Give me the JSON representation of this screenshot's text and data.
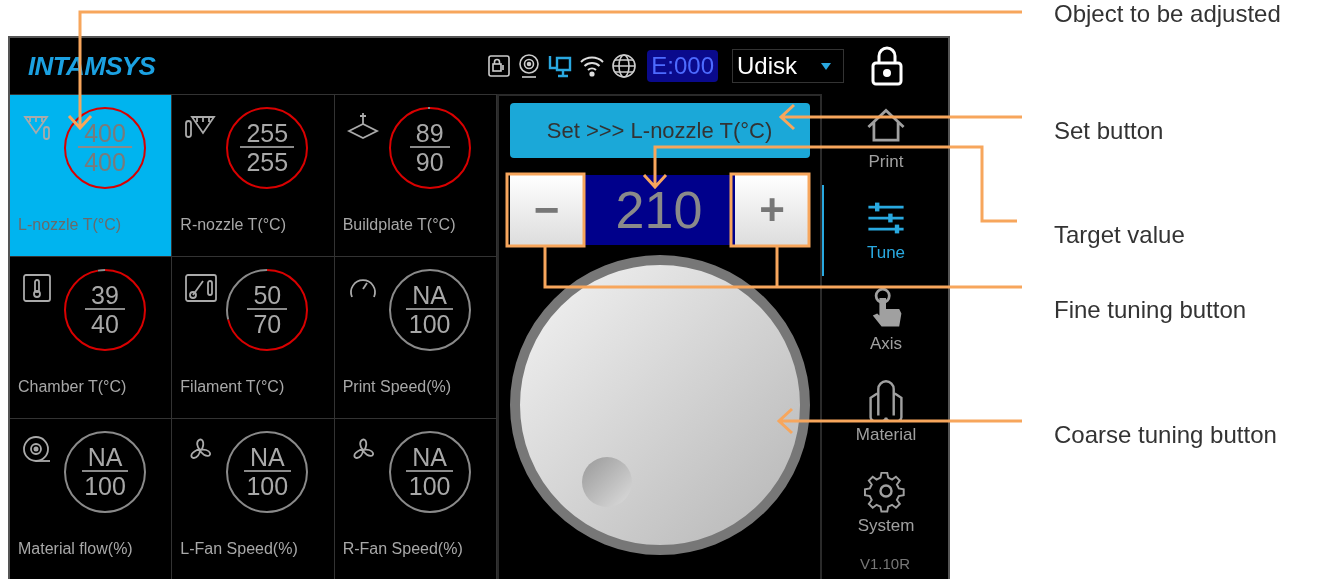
{
  "logo": "INTAMSYS",
  "status": {
    "error_code": "E:000",
    "storage": "Udisk"
  },
  "tiles": [
    {
      "kind": "nozzle-left",
      "current": "400",
      "target": "400",
      "label": "L-nozzle T(°C)",
      "level": 1,
      "selected": true
    },
    {
      "kind": "nozzle-right",
      "current": "255",
      "target": "255",
      "label": "R-nozzle T(°C)",
      "level": 1,
      "selected": false
    },
    {
      "kind": "buildplate",
      "current": "89",
      "target": "90",
      "label": "Buildplate T(°C)",
      "level": 0.99,
      "selected": false
    },
    {
      "kind": "chamber",
      "current": "39",
      "target": "40",
      "label": "Chamber T(°C)",
      "level": 0.97,
      "selected": false
    },
    {
      "kind": "filament",
      "current": "50",
      "target": "70",
      "label": "Filament T(°C)",
      "level": 0.71,
      "selected": false
    },
    {
      "kind": "speed",
      "current": "NA",
      "target": "100",
      "label": "Print Speed(%)",
      "level": 0,
      "selected": false
    },
    {
      "kind": "flow",
      "current": "NA",
      "target": "100",
      "label": "Material flow(%)",
      "level": 0,
      "selected": false
    },
    {
      "kind": "fan",
      "current": "NA",
      "target": "100",
      "label": "L-Fan Speed(%)",
      "level": 0,
      "selected": false
    },
    {
      "kind": "fan",
      "current": "NA",
      "target": "100",
      "label": "R-Fan Speed(%)",
      "level": 0,
      "selected": false
    }
  ],
  "set_button": "Set >>> L-nozzle T(°C)",
  "adjuster": {
    "minus": "−",
    "value": "210",
    "plus": "+"
  },
  "nav": [
    {
      "kind": "print",
      "label": "Print",
      "selected": false
    },
    {
      "kind": "tune",
      "label": "Tune",
      "selected": true
    },
    {
      "kind": "axis",
      "label": "Axis",
      "selected": false
    },
    {
      "kind": "material",
      "label": "Material",
      "selected": false
    },
    {
      "kind": "system",
      "label": "System",
      "selected": false
    }
  ],
  "version": "V1.10R",
  "annotations": [
    "Object to be adjusted",
    "Set button",
    "Target value",
    "Fine tuning button",
    "Coarse tuning button"
  ]
}
